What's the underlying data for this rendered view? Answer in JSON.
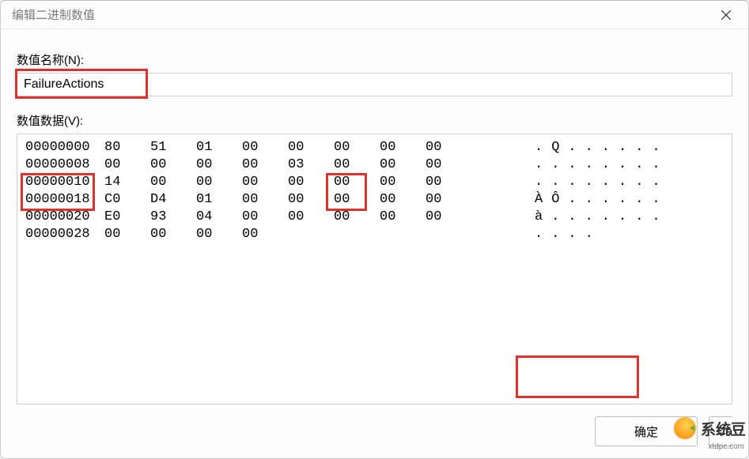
{
  "dialog": {
    "title": "编辑二进制数值",
    "labels": {
      "name": "数值名称(N):",
      "data": "数值数据(V):"
    },
    "value_name": "FailureActions",
    "hex": {
      "rows": [
        {
          "offset": "00000000",
          "b": [
            "80",
            "51",
            "01",
            "00",
            "00",
            "00",
            "00",
            "00"
          ],
          "ascii": ".Q......"
        },
        {
          "offset": "00000008",
          "b": [
            "00",
            "00",
            "00",
            "00",
            "03",
            "00",
            "00",
            "00"
          ],
          "ascii": "........"
        },
        {
          "offset": "00000010",
          "b": [
            "14",
            "00",
            "00",
            "00",
            "00",
            "00",
            "00",
            "00"
          ],
          "ascii": "........"
        },
        {
          "offset": "00000018",
          "b": [
            "C0",
            "D4",
            "01",
            "00",
            "00",
            "00",
            "00",
            "00"
          ],
          "ascii": "ÀÔ......"
        },
        {
          "offset": "00000020",
          "b": [
            "E0",
            "93",
            "04",
            "00",
            "00",
            "00",
            "00",
            "00"
          ],
          "ascii": "à......."
        },
        {
          "offset": "00000028",
          "b": [
            "00",
            "00",
            "00",
            "00",
            "",
            "",
            "",
            ""
          ],
          "ascii": "...."
        }
      ]
    },
    "buttons": {
      "ok": "确定",
      "cancel_partial": "Cā"
    }
  },
  "watermark": {
    "brand": "系统豆",
    "url": "xtdpc.com"
  }
}
